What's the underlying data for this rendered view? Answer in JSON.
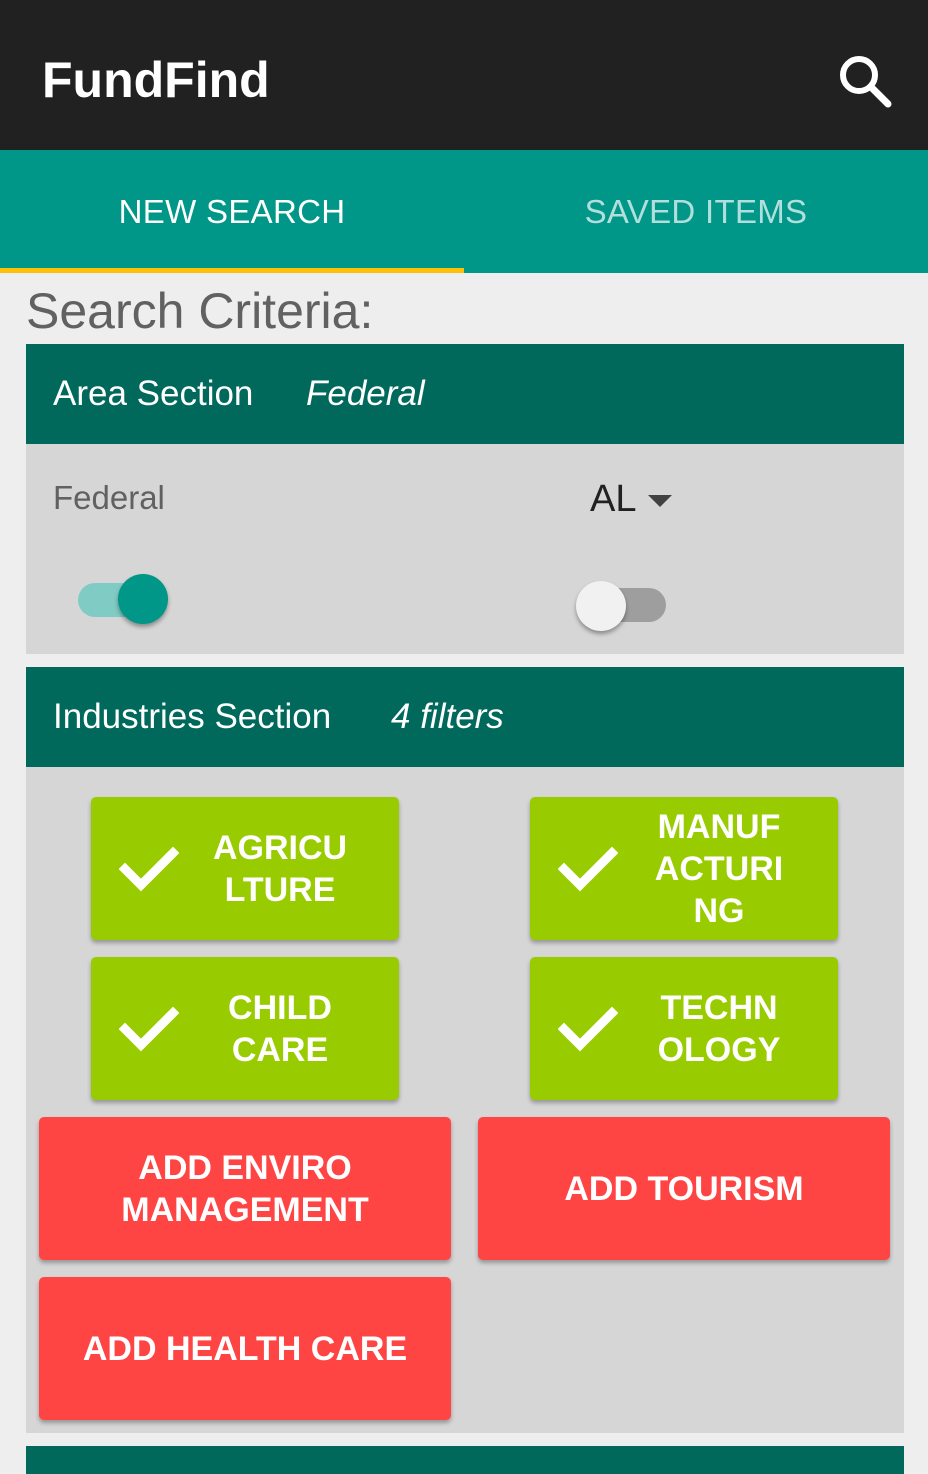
{
  "app": {
    "title": "FundFind",
    "search_icon": "search-icon"
  },
  "tabs": [
    {
      "label": "NEW SEARCH",
      "active": true
    },
    {
      "label": "SAVED ITEMS",
      "active": false
    }
  ],
  "criteria_title": "Search Criteria:",
  "area_section": {
    "label": "Area Section",
    "value": "Federal",
    "federal_label": "Federal",
    "federal_toggle_on": true,
    "state_selected": "AL",
    "state_toggle_on": false
  },
  "industries_section": {
    "label": "Industries Section",
    "value": "4 filters",
    "selected": [
      {
        "label": "AGRICULTURE"
      },
      {
        "label": "MANUFACTURING"
      },
      {
        "label": "CHILD CARE"
      },
      {
        "label": "TECHNOLOGY"
      }
    ],
    "add_buttons": [
      {
        "label": "ADD ENVIRO MANAGEMENT"
      },
      {
        "label": "ADD TOURISM"
      },
      {
        "label": "ADD HEALTH CARE"
      }
    ]
  },
  "colors": {
    "appbar": "#212121",
    "tabs": "#009688",
    "indicator": "#ffc107",
    "section_header": "#00695c",
    "selected_chip": "#99cc00",
    "add_chip": "#ff4444"
  }
}
